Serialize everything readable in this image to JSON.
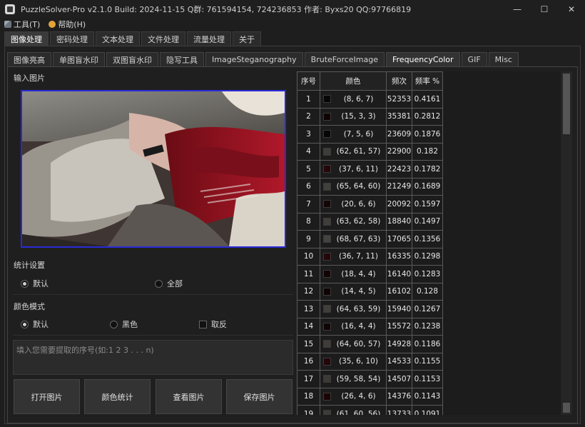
{
  "window": {
    "title": "PuzzleSolver-Pro v2.1.0  Build: 2024-11-15  Q群: 761594154, 724236853  作者: Byxs20  QQ:97766819",
    "minimize": "—",
    "maximize": "☐",
    "close": "✕"
  },
  "menu": [
    {
      "label": "工具(T)",
      "icon": "tools-icon"
    },
    {
      "label": "帮助(H)",
      "icon": "help-icon"
    }
  ],
  "main_tabs": [
    {
      "label": "图像处理",
      "active": true
    },
    {
      "label": "密码处理",
      "active": false
    },
    {
      "label": "文本处理",
      "active": false
    },
    {
      "label": "文件处理",
      "active": false
    },
    {
      "label": "流量处理",
      "active": false
    },
    {
      "label": "关于",
      "active": false
    }
  ],
  "sub_tabs": [
    {
      "label": "图像亮高",
      "active": false
    },
    {
      "label": "单图盲水印",
      "active": false
    },
    {
      "label": "双图盲水印",
      "active": false
    },
    {
      "label": "隐写工具",
      "active": false
    },
    {
      "label": "ImageSteganography",
      "active": false
    },
    {
      "label": "BruteForceImage",
      "active": false
    },
    {
      "label": "FrequencyColor",
      "active": true
    },
    {
      "label": "GIF",
      "active": false
    },
    {
      "label": "Misc",
      "active": false
    }
  ],
  "left": {
    "input_label": "输入图片",
    "stats_label": "统计设置",
    "stats_options": [
      {
        "label": "默认",
        "checked": true
      },
      {
        "label": "全部",
        "checked": false
      }
    ],
    "color_mode_label": "颜色模式",
    "color_mode_options": [
      {
        "label": "默认",
        "checked": true
      },
      {
        "label": "黑色",
        "checked": false
      }
    ],
    "invert_label": "取反",
    "invert_checked": false,
    "input_placeholder": "填入您需要提取的序号(如:1 2 3 . . . n)",
    "buttons": [
      "打开图片",
      "颜色统计",
      "查看图片",
      "保存图片"
    ]
  },
  "table": {
    "headers": [
      "序号",
      "颜色",
      "频次",
      "频率 %"
    ],
    "rows": [
      {
        "idx": "1",
        "rgb": "(8, 6, 7)",
        "freq": "52353",
        "pct": "0.4161",
        "hex": "#080607"
      },
      {
        "idx": "2",
        "rgb": "(15, 3, 3)",
        "freq": "35381",
        "pct": "0.2812",
        "hex": "#0f0303"
      },
      {
        "idx": "3",
        "rgb": "(7, 5, 6)",
        "freq": "23609",
        "pct": "0.1876",
        "hex": "#070506"
      },
      {
        "idx": "4",
        "rgb": "(62, 61, 57)",
        "freq": "22900",
        "pct": "0.182",
        "hex": "#3e3d39"
      },
      {
        "idx": "5",
        "rgb": "(37, 6, 11)",
        "freq": "22423",
        "pct": "0.1782",
        "hex": "#25060b"
      },
      {
        "idx": "6",
        "rgb": "(65, 64, 60)",
        "freq": "21249",
        "pct": "0.1689",
        "hex": "#41403c"
      },
      {
        "idx": "7",
        "rgb": "(20, 6, 6)",
        "freq": "20092",
        "pct": "0.1597",
        "hex": "#140606"
      },
      {
        "idx": "8",
        "rgb": "(63, 62, 58)",
        "freq": "18840",
        "pct": "0.1497",
        "hex": "#3f3e3a"
      },
      {
        "idx": "9",
        "rgb": "(68, 67, 63)",
        "freq": "17065",
        "pct": "0.1356",
        "hex": "#44433f"
      },
      {
        "idx": "10",
        "rgb": "(36, 7, 11)",
        "freq": "16335",
        "pct": "0.1298",
        "hex": "#24070b"
      },
      {
        "idx": "11",
        "rgb": "(18, 4, 4)",
        "freq": "16140",
        "pct": "0.1283",
        "hex": "#120404"
      },
      {
        "idx": "12",
        "rgb": "(14, 4, 5)",
        "freq": "16102",
        "pct": "0.128",
        "hex": "#0e0405"
      },
      {
        "idx": "13",
        "rgb": "(64, 63, 59)",
        "freq": "15940",
        "pct": "0.1267",
        "hex": "#403f3b"
      },
      {
        "idx": "14",
        "rgb": "(16, 4, 4)",
        "freq": "15572",
        "pct": "0.1238",
        "hex": "#100404"
      },
      {
        "idx": "15",
        "rgb": "(64, 60, 57)",
        "freq": "14928",
        "pct": "0.1186",
        "hex": "#403c39"
      },
      {
        "idx": "16",
        "rgb": "(35, 6, 10)",
        "freq": "14533",
        "pct": "0.1155",
        "hex": "#23060a"
      },
      {
        "idx": "17",
        "rgb": "(59, 58, 54)",
        "freq": "14507",
        "pct": "0.1153",
        "hex": "#3b3a36"
      },
      {
        "idx": "18",
        "rgb": "(26, 4, 6)",
        "freq": "14376",
        "pct": "0.1143",
        "hex": "#1a0406"
      },
      {
        "idx": "19",
        "rgb": "(61, 60, 56)",
        "freq": "13733",
        "pct": "0.1091",
        "hex": "#3d3c38"
      }
    ]
  }
}
